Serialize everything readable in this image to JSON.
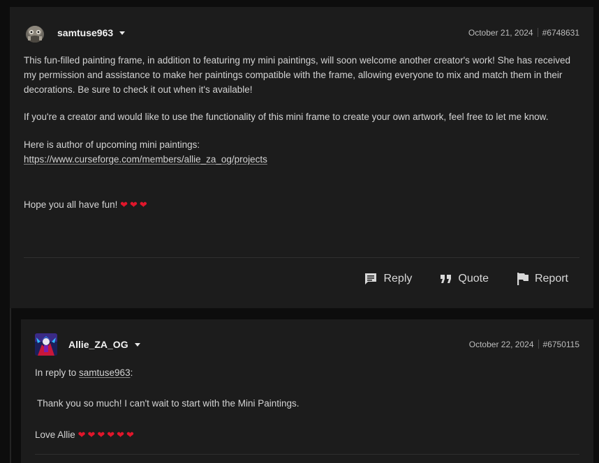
{
  "comments": [
    {
      "username": "samtuse963",
      "date": "October 21, 2024",
      "id": "#6748631",
      "paragraphs": [
        "This fun-filled painting frame, in addition to featuring my mini paintings, will soon welcome another creator's work! She has received my permission and assistance to make her paintings compatible with the frame, allowing everyone to mix and match them in their decorations. Be sure to check it out when it's available!",
        "If you're a creator and would like to use the functionality of this mini frame to create your own artwork, feel free to let me know.",
        "Here is author of upcoming mini paintings:"
      ],
      "link": "https://www.curseforge.com/members/allie_za_og/projects",
      "closing": "Hope you all have fun!",
      "closing_hearts": "❤❤❤",
      "actions": {
        "reply": "Reply",
        "quote": "Quote",
        "report": "Report"
      }
    },
    {
      "username": "Allie_ZA_OG",
      "date": "October 22, 2024",
      "id": "#6750115",
      "reply_prefix": "In reply to ",
      "reply_to": "samtuse963",
      "reply_suffix": ":",
      "message": "Thank you so much! I can't wait to start with the Mini Paintings.",
      "signoff": "Love Allie",
      "signoff_hearts": "❤❤❤❤❤❤"
    }
  ],
  "colors": {
    "background": "#0d0d0d",
    "card": "#1c1c1c",
    "heart": "#e0162b"
  }
}
